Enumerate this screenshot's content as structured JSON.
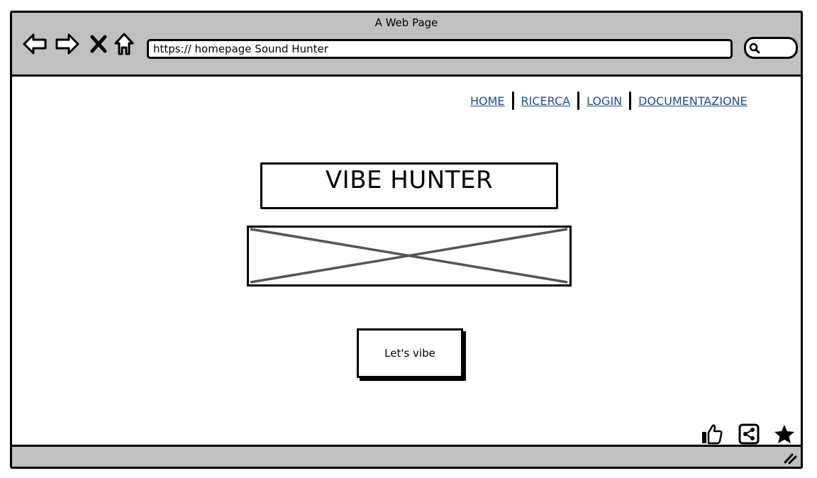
{
  "window": {
    "title": "A Web Page",
    "url": "https:// homepage Sound Hunter"
  },
  "toolbar": {
    "back_icon": "arrow-left-icon",
    "forward_icon": "arrow-right-icon",
    "close_icon": "x-icon",
    "home_icon": "home-icon",
    "search_icon": "search-icon"
  },
  "nav": {
    "items": [
      {
        "label": "HOME"
      },
      {
        "label": "RICERCA"
      },
      {
        "label": "LOGIN"
      },
      {
        "label": "DOCUMENTAZIONE"
      }
    ],
    "link_color": "#1f4c8f"
  },
  "hero": {
    "title": "VIBE HUNTER",
    "cta_label": "Let's vibe"
  },
  "actions": {
    "icons": [
      "thumbs-up-icon",
      "share-icon",
      "star-icon"
    ]
  },
  "colors": {
    "chrome": "#c0c0c0",
    "placeholder_stroke": "#555555"
  }
}
